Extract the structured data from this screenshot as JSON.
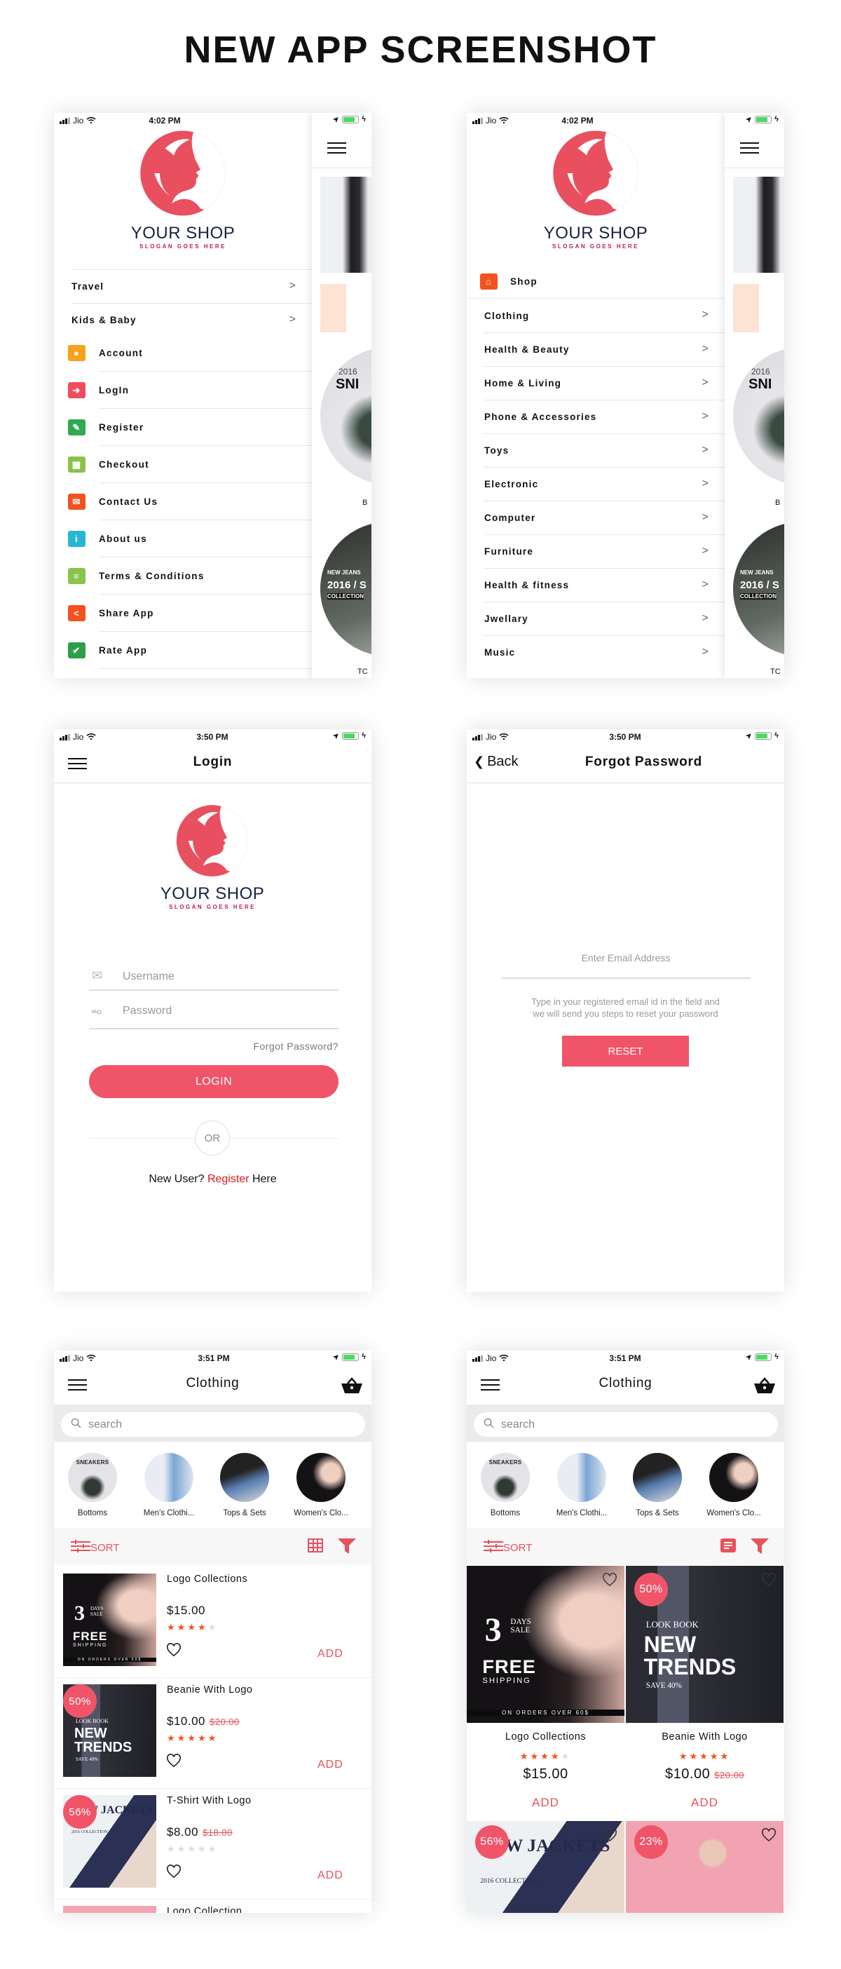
{
  "page_title": "NEW APP SCREENSHOT",
  "brand": {
    "name": "YOUR SHOP",
    "slogan": "SLOGAN GOES HERE"
  },
  "colors": {
    "accent": "#f05468",
    "star": "#f4511e",
    "logo": "#e9505f",
    "register_link": "#e0161e"
  },
  "peek": {
    "hero_year": "2016",
    "hero_word": "SNI",
    "caption_b": "B",
    "jeans_title": "NEW JEANS",
    "jeans_year": "2016 / S",
    "jeans_sub": "COLLECTION",
    "footer": "TC"
  },
  "screens": {
    "menu1": {
      "status": {
        "carrier": "Jio",
        "time": "4:02 PM"
      },
      "categories": [
        {
          "label": "Travel"
        },
        {
          "label": "Kids & Baby"
        }
      ],
      "links": [
        {
          "label": "Account",
          "icon": "account-icon",
          "glyph": "●",
          "color": "#f7a21b"
        },
        {
          "label": "LogIn",
          "icon": "login-icon",
          "glyph": "➜",
          "color": "#ef4d5e"
        },
        {
          "label": "Register",
          "icon": "register-icon",
          "glyph": "✎",
          "color": "#2eaa53"
        },
        {
          "label": "Checkout",
          "icon": "basket-icon",
          "glyph": "▦",
          "color": "#8bc34a"
        },
        {
          "label": "Contact Us",
          "icon": "mail-icon",
          "glyph": "✉",
          "color": "#f4511e"
        },
        {
          "label": "About us",
          "icon": "info-icon",
          "glyph": "i",
          "color": "#29b6d6"
        },
        {
          "label": "Terms & Conditions",
          "icon": "document-icon",
          "glyph": "≡",
          "color": "#8bc34a"
        },
        {
          "label": "Share App",
          "icon": "share-icon",
          "glyph": "<",
          "color": "#f4511e"
        },
        {
          "label": "Rate App",
          "icon": "thumbs-up-icon",
          "glyph": "✔",
          "color": "#2e9e48"
        }
      ]
    },
    "menu2": {
      "status": {
        "carrier": "Jio",
        "time": "4:02 PM"
      },
      "shop": {
        "label": "Shop",
        "icon": "home-icon",
        "color": "#f4511e"
      },
      "categories": [
        {
          "label": "Clothing"
        },
        {
          "label": "Health & Beauty"
        },
        {
          "label": "Home & Living"
        },
        {
          "label": "Phone & Accessories"
        },
        {
          "label": "Toys"
        },
        {
          "label": "Electronic"
        },
        {
          "label": "Computer"
        },
        {
          "label": "Furniture"
        },
        {
          "label": "Health & fitness"
        },
        {
          "label": "Jwellary"
        },
        {
          "label": "Music"
        }
      ]
    },
    "login": {
      "status": {
        "carrier": "Jio",
        "time": "3:50 PM"
      },
      "title": "Login",
      "username_placeholder": "Username",
      "password_placeholder": "Password",
      "forgot": "Forgot Password?",
      "login_button": "LOGIN",
      "or": "OR",
      "new_user": "New User?",
      "register": "Register",
      "here": "Here"
    },
    "forgot": {
      "status": {
        "carrier": "Jio",
        "time": "3:50 PM"
      },
      "back": "Back",
      "title": "Forgot Password",
      "email_placeholder": "Enter Email Address",
      "help_line1": "Type in your registered email id in the field and",
      "help_line2": "we will send you steps to reset your password",
      "reset_button": "RESET"
    },
    "list": {
      "status": {
        "carrier": "Jio",
        "time": "3:51 PM"
      },
      "title": "Clothing",
      "search_placeholder": "search",
      "sort": "SORT",
      "view_toggle_icon": "grid-icon",
      "products": [
        {
          "name": "Logo Collections",
          "price": "$15.00",
          "old_price": "",
          "rating": 4,
          "discount": "",
          "image": "sunglasses",
          "add": "ADD"
        },
        {
          "name": "Beanie With Logo",
          "price": "$10.00",
          "old_price": "$20.00",
          "rating": 5,
          "discount": "50%",
          "image": "trends",
          "add": "ADD"
        },
        {
          "name": "T-Shirt With Logo",
          "price": "$8.00",
          "old_price": "$18.00",
          "rating": 0,
          "discount": "56%",
          "image": "jackets",
          "add": "ADD"
        },
        {
          "name": "Logo Collection",
          "price": "",
          "old_price": "",
          "rating": 0,
          "discount": "",
          "image": "pink",
          "add": ""
        }
      ]
    },
    "grid": {
      "status": {
        "carrier": "Jio",
        "time": "3:51 PM"
      },
      "title": "Clothing",
      "search_placeholder": "search",
      "sort": "SORT",
      "view_toggle_icon": "list-icon",
      "products": [
        {
          "name": "Logo Collections",
          "price": "$15.00",
          "old_price": "",
          "rating": 4,
          "discount": "",
          "image": "sunglasses",
          "add": "ADD"
        },
        {
          "name": "Beanie With Logo",
          "price": "$10.00",
          "old_price": "$20.00",
          "rating": 5,
          "discount": "50%",
          "image": "trends",
          "add": "ADD"
        },
        {
          "name": "",
          "price": "",
          "old_price": "",
          "rating": 0,
          "discount": "56%",
          "image": "jackets",
          "add": ""
        },
        {
          "name": "",
          "price": "",
          "old_price": "",
          "rating": 0,
          "discount": "23%",
          "image": "pink",
          "add": ""
        }
      ]
    }
  },
  "shop_categories": [
    {
      "label": "Bottoms"
    },
    {
      "label": "Men's Clothi..."
    },
    {
      "label": "Tops & Sets"
    },
    {
      "label": "Women's Clo..."
    }
  ],
  "banners": {
    "sunglasses": {
      "big": "3",
      "small": "DAYS SALE",
      "headline": "FREE",
      "sub": "SHIPPING",
      "footer": "ON ORDERS OVER 60$"
    },
    "trends": {
      "kicker": "LOOK BOOK",
      "headline": "NEW TRENDS",
      "sub": "SAVE 40%"
    },
    "jackets": {
      "headline": "NEW JACKETS",
      "sub": "2016 COLLECTION"
    },
    "sneakers": {
      "kicker": "SNEAKERS"
    }
  }
}
